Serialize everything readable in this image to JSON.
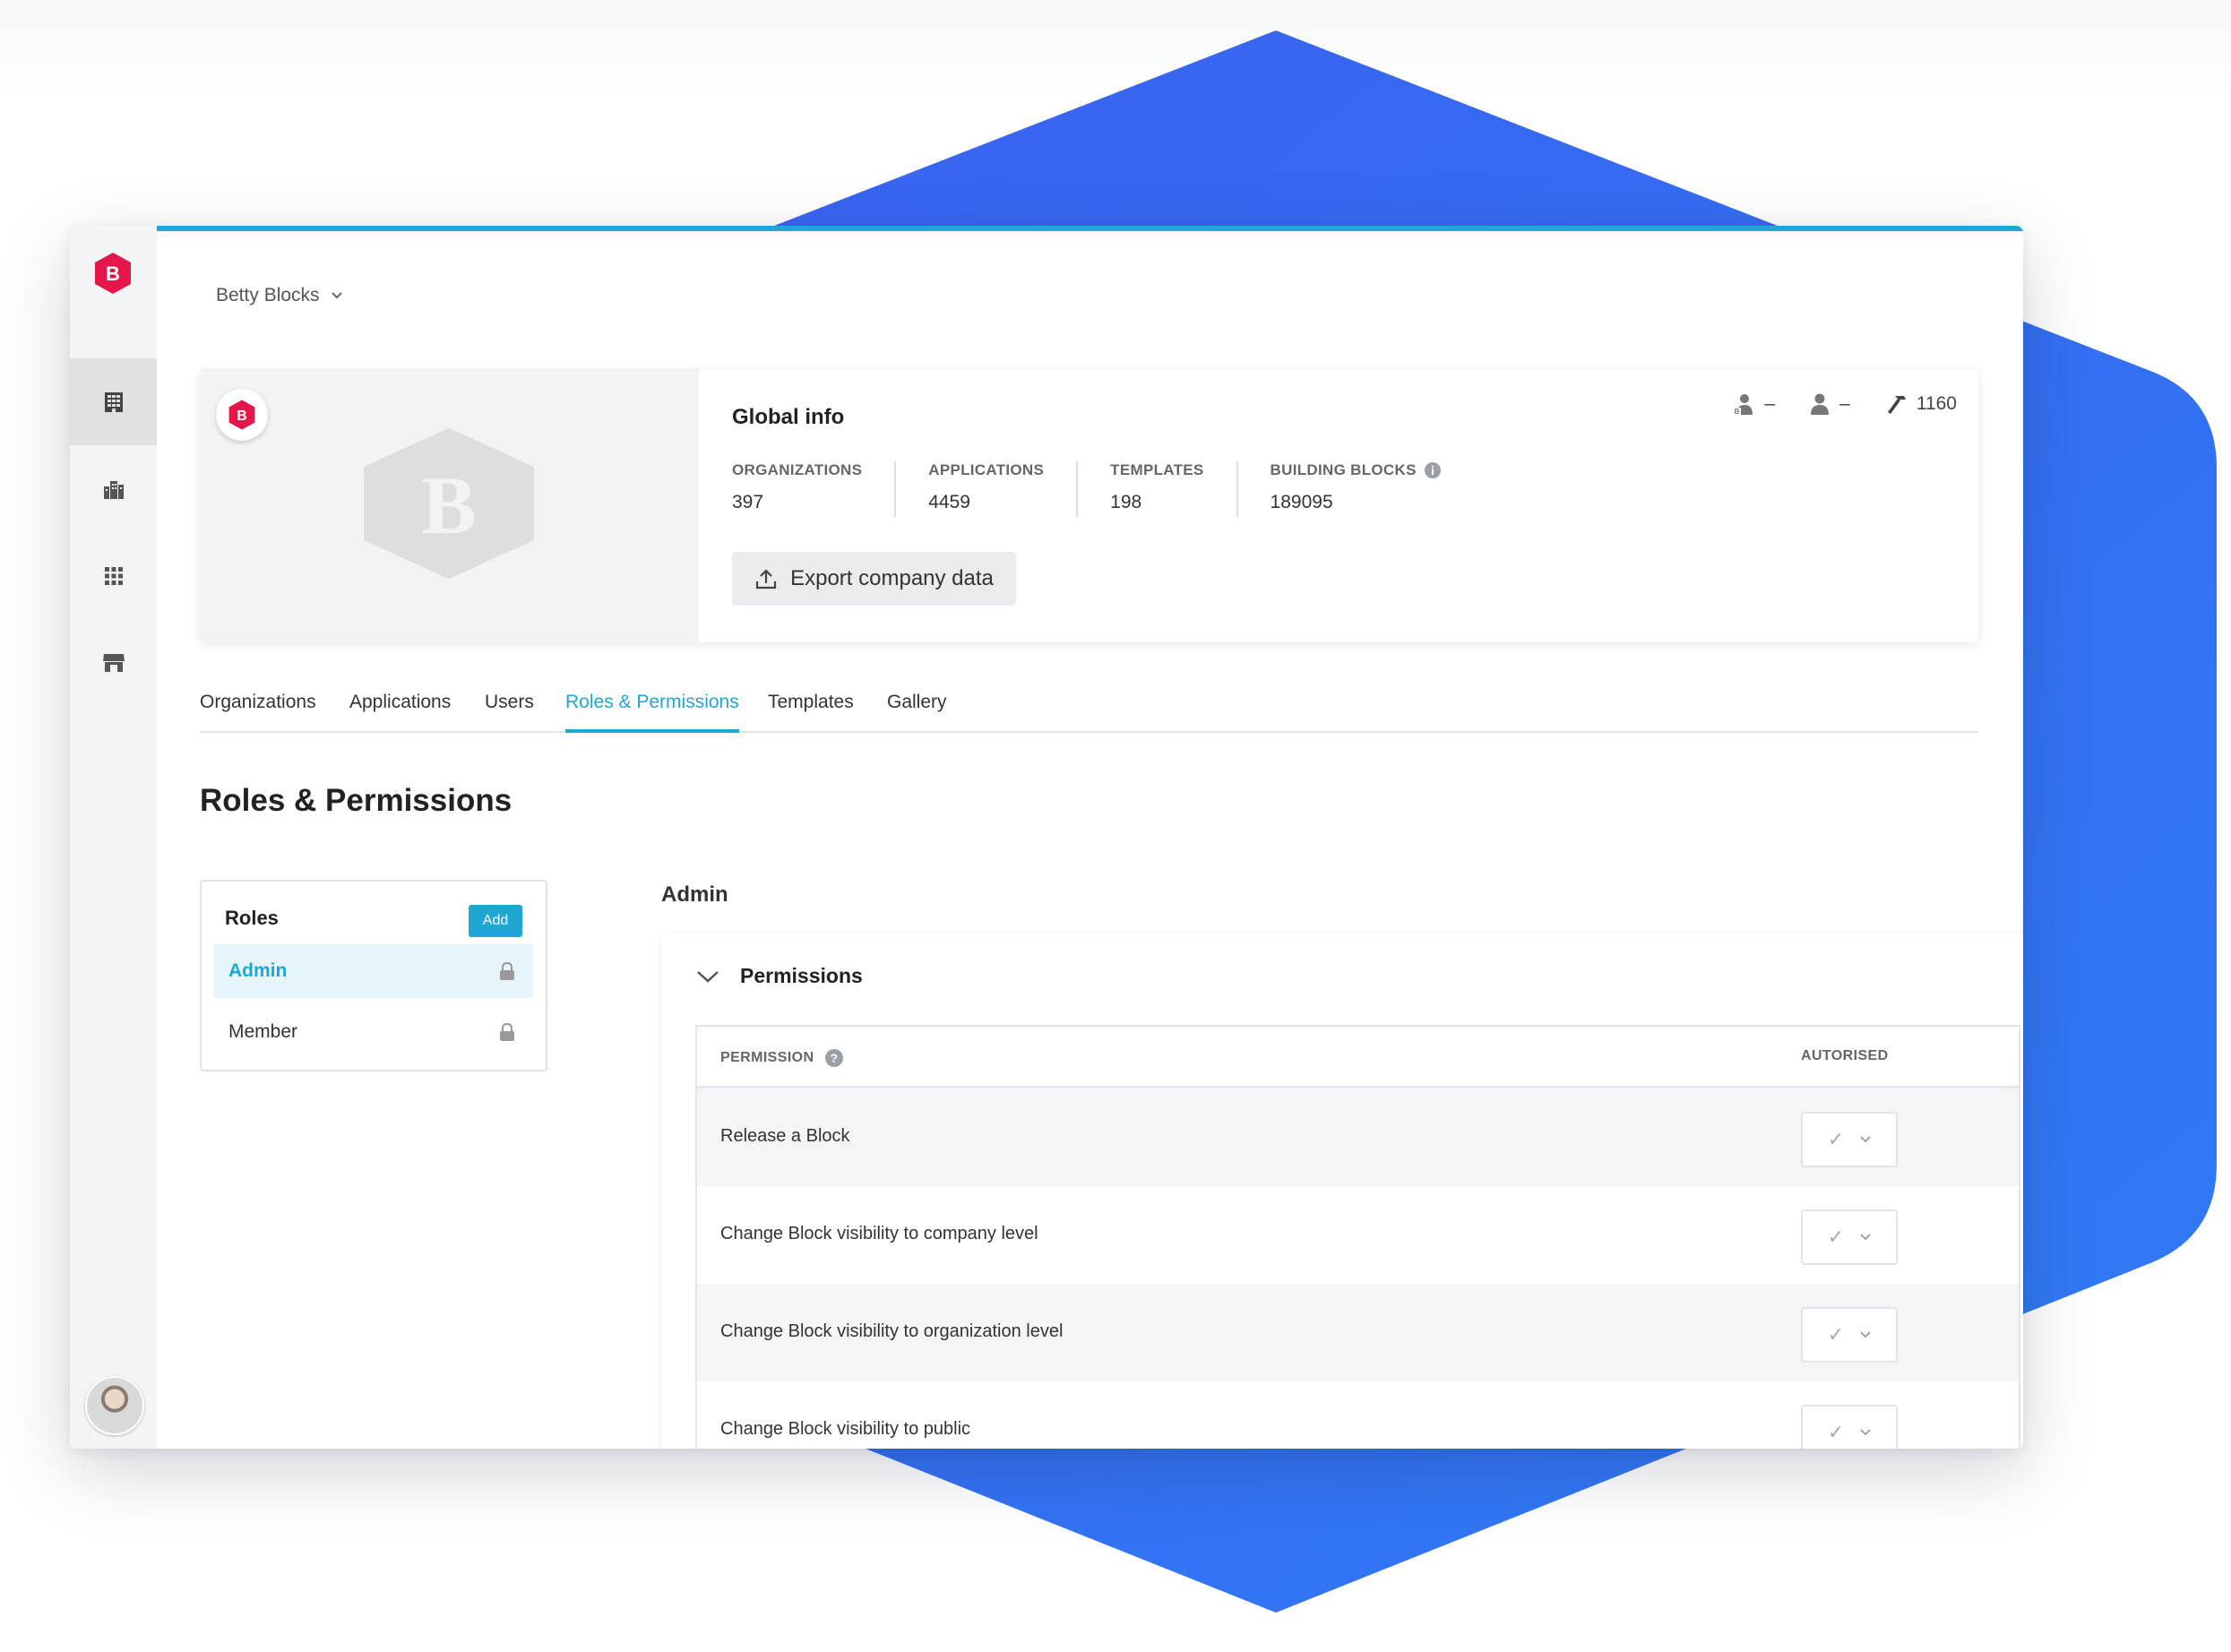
{
  "company": {
    "name": "Betty Blocks"
  },
  "sidebar": {
    "items": [
      {
        "icon": "building-grid-icon",
        "active": true
      },
      {
        "icon": "city-icon",
        "active": false
      },
      {
        "icon": "apps-grid-icon",
        "active": false
      },
      {
        "icon": "store-icon",
        "active": false
      }
    ]
  },
  "global_info": {
    "title": "Global info",
    "stats": [
      {
        "label": "ORGANIZATIONS",
        "value": "397"
      },
      {
        "label": "APPLICATIONS",
        "value": "4459"
      },
      {
        "label": "TEMPLATES",
        "value": "198"
      },
      {
        "label": "BUILDING BLOCKS",
        "value": "189095",
        "info_icon": true
      }
    ],
    "export_label": "Export company data",
    "counters": [
      {
        "icon": "builders-icon",
        "value": "–"
      },
      {
        "icon": "user-icon",
        "value": "–"
      },
      {
        "icon": "hammer-icon",
        "value": "1160"
      }
    ]
  },
  "tabs": [
    {
      "label": "Organizations"
    },
    {
      "label": "Applications"
    },
    {
      "label": "Users"
    },
    {
      "label": "Roles & Permissions",
      "active": true
    },
    {
      "label": "Templates"
    },
    {
      "label": "Gallery"
    }
  ],
  "page": {
    "title": "Roles & Permissions"
  },
  "roles": {
    "header": "Roles",
    "add_label": "Add",
    "items": [
      {
        "name": "Admin",
        "active": true
      },
      {
        "name": "Member",
        "active": false
      }
    ]
  },
  "detail": {
    "title": "Admin",
    "permissions_label": "Permissions",
    "columns": {
      "permission": "PERMISSION",
      "authorised": "AUTORISED"
    },
    "rows": [
      {
        "name": "Release a Block",
        "value": "✓"
      },
      {
        "name": "Change Block visibility to company level",
        "value": "✓"
      },
      {
        "name": "Change Block visibility to organization level",
        "value": "✓"
      },
      {
        "name": "Change Block visibility to public",
        "value": "✓"
      }
    ]
  },
  "colors": {
    "accent": "#1ea7d4",
    "brand_red": "#e5174a",
    "hex_blue": "#3366f2"
  }
}
